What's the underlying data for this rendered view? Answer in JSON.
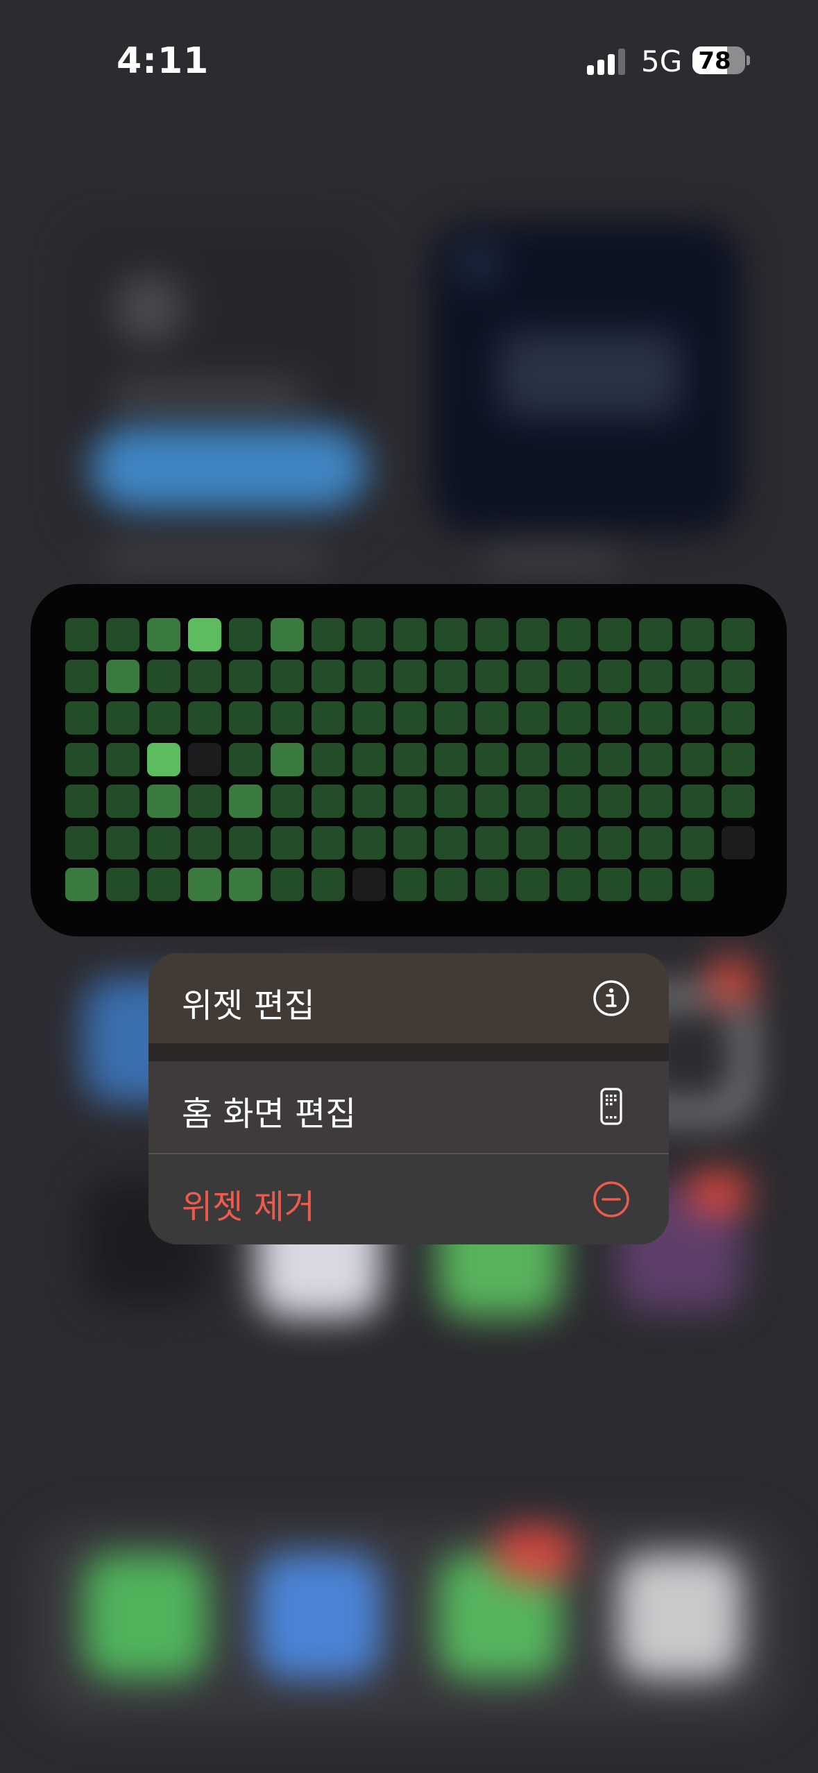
{
  "status_bar": {
    "time": "4:11",
    "network": "5G",
    "battery_percent": "78",
    "battery_level": 0.78,
    "signal_bars_active": 3
  },
  "widget": {
    "rows": 7,
    "cols": 17,
    "palette": {
      "0": "#1c1c1e",
      "1": "#234d28",
      "2": "#3a7a3e",
      "3": "#5dbb60"
    },
    "levels": [
      [
        1,
        1,
        2,
        3,
        1,
        2,
        1,
        1,
        1,
        1,
        1,
        1,
        1,
        1,
        1,
        1,
        1
      ],
      [
        1,
        2,
        1,
        1,
        1,
        1,
        1,
        1,
        1,
        1,
        1,
        1,
        1,
        1,
        1,
        1,
        1
      ],
      [
        1,
        1,
        1,
        1,
        1,
        1,
        1,
        1,
        1,
        1,
        1,
        1,
        1,
        1,
        1,
        1,
        1
      ],
      [
        1,
        1,
        3,
        0,
        1,
        2,
        1,
        1,
        1,
        1,
        1,
        1,
        1,
        1,
        1,
        1,
        1
      ],
      [
        1,
        1,
        2,
        1,
        2,
        1,
        1,
        1,
        1,
        1,
        1,
        1,
        1,
        1,
        1,
        1,
        1
      ],
      [
        1,
        1,
        1,
        1,
        1,
        1,
        1,
        1,
        1,
        1,
        1,
        1,
        1,
        1,
        1,
        1,
        0
      ],
      [
        2,
        1,
        1,
        2,
        2,
        1,
        1,
        0,
        1,
        1,
        1,
        1,
        1,
        1,
        1,
        1,
        null
      ]
    ]
  },
  "context_menu": {
    "edit_widget": {
      "label": "위젯 편집",
      "icon": "info-circle-icon"
    },
    "edit_home_screen": {
      "label": "홈 화면 편집",
      "icon": "phone-apps-icon"
    },
    "remove_widget": {
      "label": "위젯 제거",
      "icon": "minus-circle-icon"
    },
    "destructive_color": "#ee5b4d"
  }
}
